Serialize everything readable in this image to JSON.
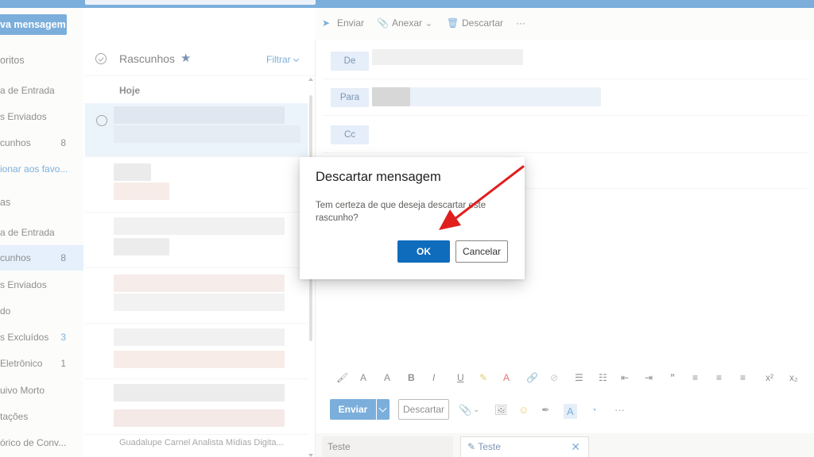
{
  "folders": {
    "new_message": "va mensagem",
    "items": [
      {
        "label": "oritos",
        "count": ""
      },
      {
        "label": "a de Entrada",
        "count": ""
      },
      {
        "label": "s Enviados",
        "count": ""
      },
      {
        "label": "cunhos",
        "count": "8"
      },
      {
        "label": "ionar aos favo...",
        "count": ""
      },
      {
        "label": "as",
        "count": ""
      },
      {
        "label": "a de Entrada",
        "count": ""
      },
      {
        "label": "cunhos",
        "count": "8"
      },
      {
        "label": "s Enviados",
        "count": ""
      },
      {
        "label": "do",
        "count": ""
      },
      {
        "label": "s Excluídos",
        "count": "3"
      },
      {
        "label": "Eletrônico",
        "count": "1"
      },
      {
        "label": "uivo Morto",
        "count": ""
      },
      {
        "label": "tações",
        "count": ""
      },
      {
        "label": "órico de Conv...",
        "count": ""
      }
    ]
  },
  "message_list": {
    "title": "Rascunhos",
    "filter": "Filtrar",
    "group": "Hoje",
    "last_sender": "Guadalupe Carnel Analista Mídias Digita..."
  },
  "compose": {
    "toolbar": {
      "send": "Enviar",
      "attach": "Anexar",
      "discard": "Descartar",
      "more": "···"
    },
    "fields": {
      "from": "De",
      "to": "Para",
      "cc": "Cc"
    },
    "send_button": "Enviar",
    "discard_button": "Descartar",
    "tabs": [
      "Teste",
      "Teste"
    ]
  },
  "dialog": {
    "title": "Descartar mensagem",
    "text": "Tem certeza de que deseja descartar este rascunho?",
    "ok": "OK",
    "cancel": "Cancelar"
  },
  "colors": {
    "accent": "#0f6cbd",
    "annotation_arrow": "#e01e1e"
  }
}
